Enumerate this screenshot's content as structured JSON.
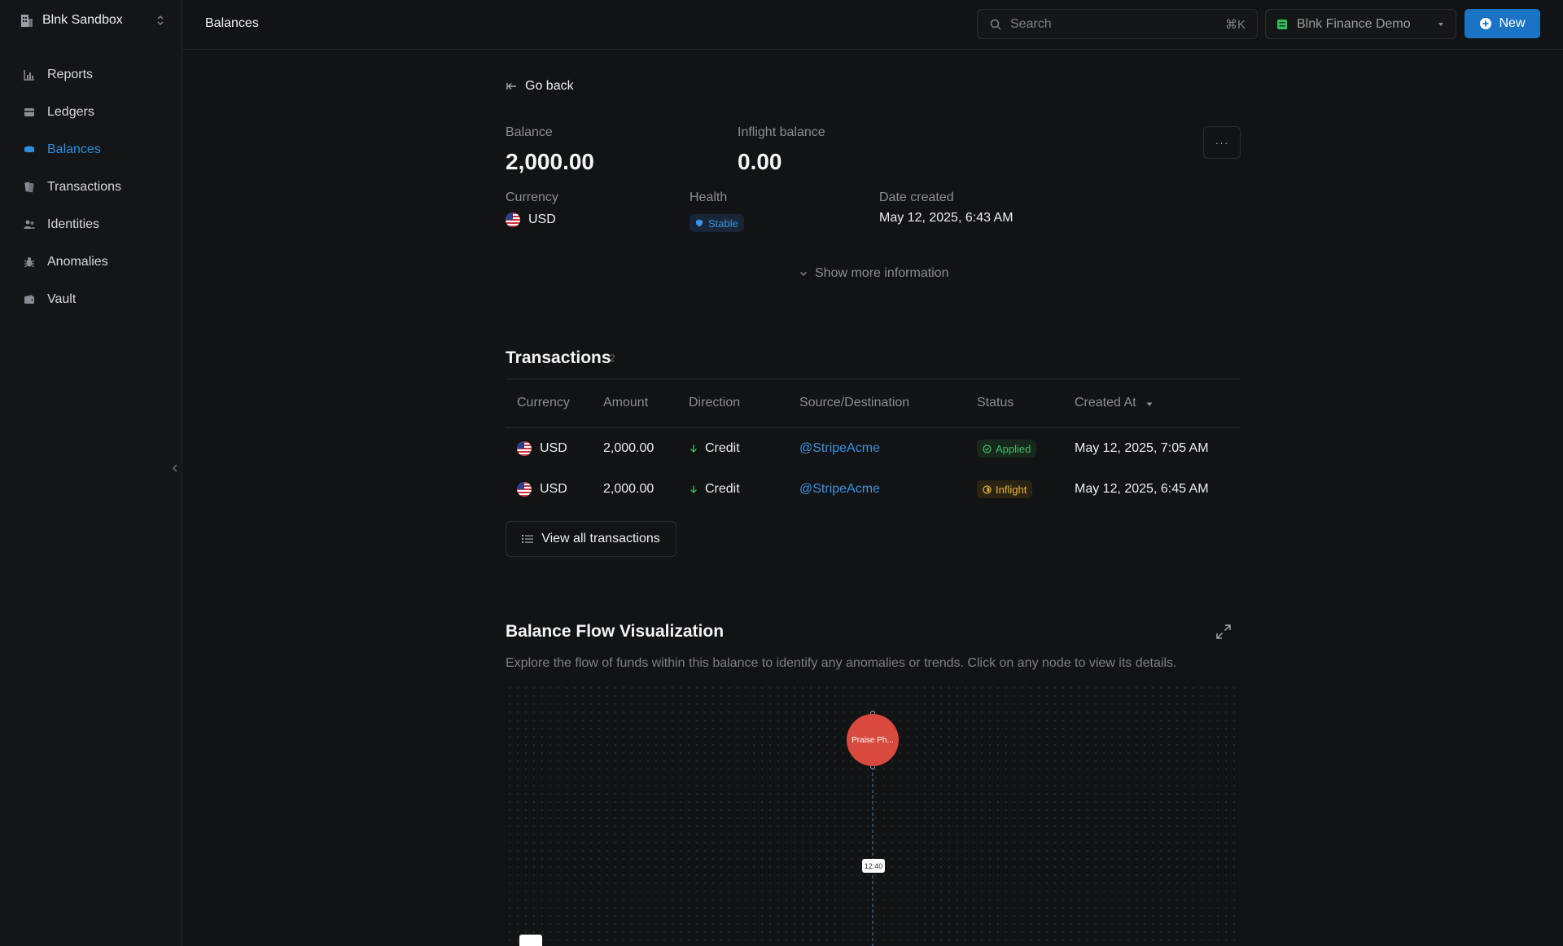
{
  "sidebar": {
    "workspace_name": "Blnk Sandbox",
    "items": [
      {
        "label": "Reports",
        "icon": "bar-chart-icon"
      },
      {
        "label": "Ledgers",
        "icon": "ledger-card-icon"
      },
      {
        "label": "Balances",
        "icon": "coins-stack-icon",
        "active": true
      },
      {
        "label": "Transactions",
        "icon": "transactions-icon"
      },
      {
        "label": "Identities",
        "icon": "users-icon"
      },
      {
        "label": "Anomalies",
        "icon": "bug-icon"
      },
      {
        "label": "Vault",
        "icon": "wallet-icon"
      }
    ]
  },
  "topbar": {
    "title": "Balances",
    "search_placeholder": "Search",
    "search_shortcut": "⌘K",
    "org_name": "Blnk Finance Demo",
    "new_label": "New"
  },
  "balance": {
    "go_back": "Go back",
    "balance_label": "Balance",
    "balance_value": "2,000.00",
    "inflight_label": "Inflight balance",
    "inflight_value": "0.00",
    "currency_label": "Currency",
    "currency_value": "USD",
    "health_label": "Health",
    "health_value": "Stable",
    "date_label": "Date created",
    "date_value": "May 12, 2025, 6:43 AM",
    "show_more": "Show more information",
    "more_glyph": "···"
  },
  "transactions": {
    "title": "Transactions",
    "count": "2",
    "columns": [
      "Currency",
      "Amount",
      "Direction",
      "Source/Destination",
      "Status",
      "Created At"
    ],
    "rows": [
      {
        "currency": "USD",
        "amount": "2,000.00",
        "direction": "Credit",
        "party": "@StripeAcme",
        "status": "Applied",
        "created": "May 12, 2025, 7:05 AM"
      },
      {
        "currency": "USD",
        "amount": "2,000.00",
        "direction": "Credit",
        "party": "@StripeAcme",
        "status": "Inflight",
        "created": "May 12, 2025, 6:45 AM"
      }
    ],
    "view_all": "View all transactions"
  },
  "flow": {
    "title": "Balance Flow Visualization",
    "description": "Explore the flow of funds within this balance to identify any anomalies or trends. Click on any node to view its details.",
    "node_label": "Praise Ph...",
    "edge_label": "12:40"
  },
  "colors": {
    "accent": "#1a73c4",
    "link": "#3a92e0",
    "applied": "#3fbf62",
    "inflight": "#e8b53a",
    "node": "#d94a3e"
  }
}
